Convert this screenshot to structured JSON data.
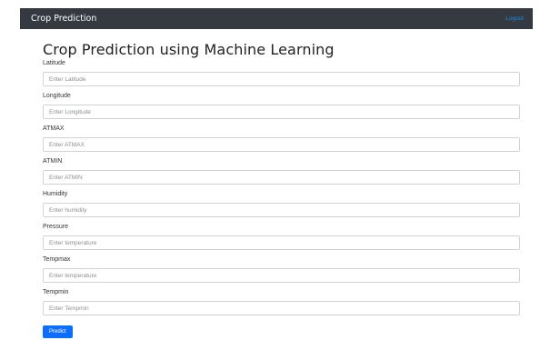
{
  "navbar": {
    "brand": "Crop Prediction",
    "logout_label": "Logout"
  },
  "main": {
    "title": "Crop Prediction using Machine Learning",
    "fields": [
      {
        "label": "Latitude",
        "placeholder": "Enter Latitude",
        "value": ""
      },
      {
        "label": "Longitude",
        "placeholder": "Enter Longitude",
        "value": ""
      },
      {
        "label": "ATMAX",
        "placeholder": "Enter ATMAX",
        "value": ""
      },
      {
        "label": "ATMIN",
        "placeholder": "Enter ATMIN",
        "value": ""
      },
      {
        "label": "Humidity",
        "placeholder": "Enter humidity",
        "value": ""
      },
      {
        "label": "Pressure",
        "placeholder": "Enter temperature",
        "value": ""
      },
      {
        "label": "Tempmax",
        "placeholder": "Enter temperature",
        "value": ""
      },
      {
        "label": "Tempmin",
        "placeholder": "Enter Tempmin",
        "value": ""
      }
    ],
    "submit_label": "Predict"
  },
  "colors": {
    "navbar_bg": "#343a40",
    "link": "#1e88e5",
    "primary_button": "#0d6efd"
  }
}
